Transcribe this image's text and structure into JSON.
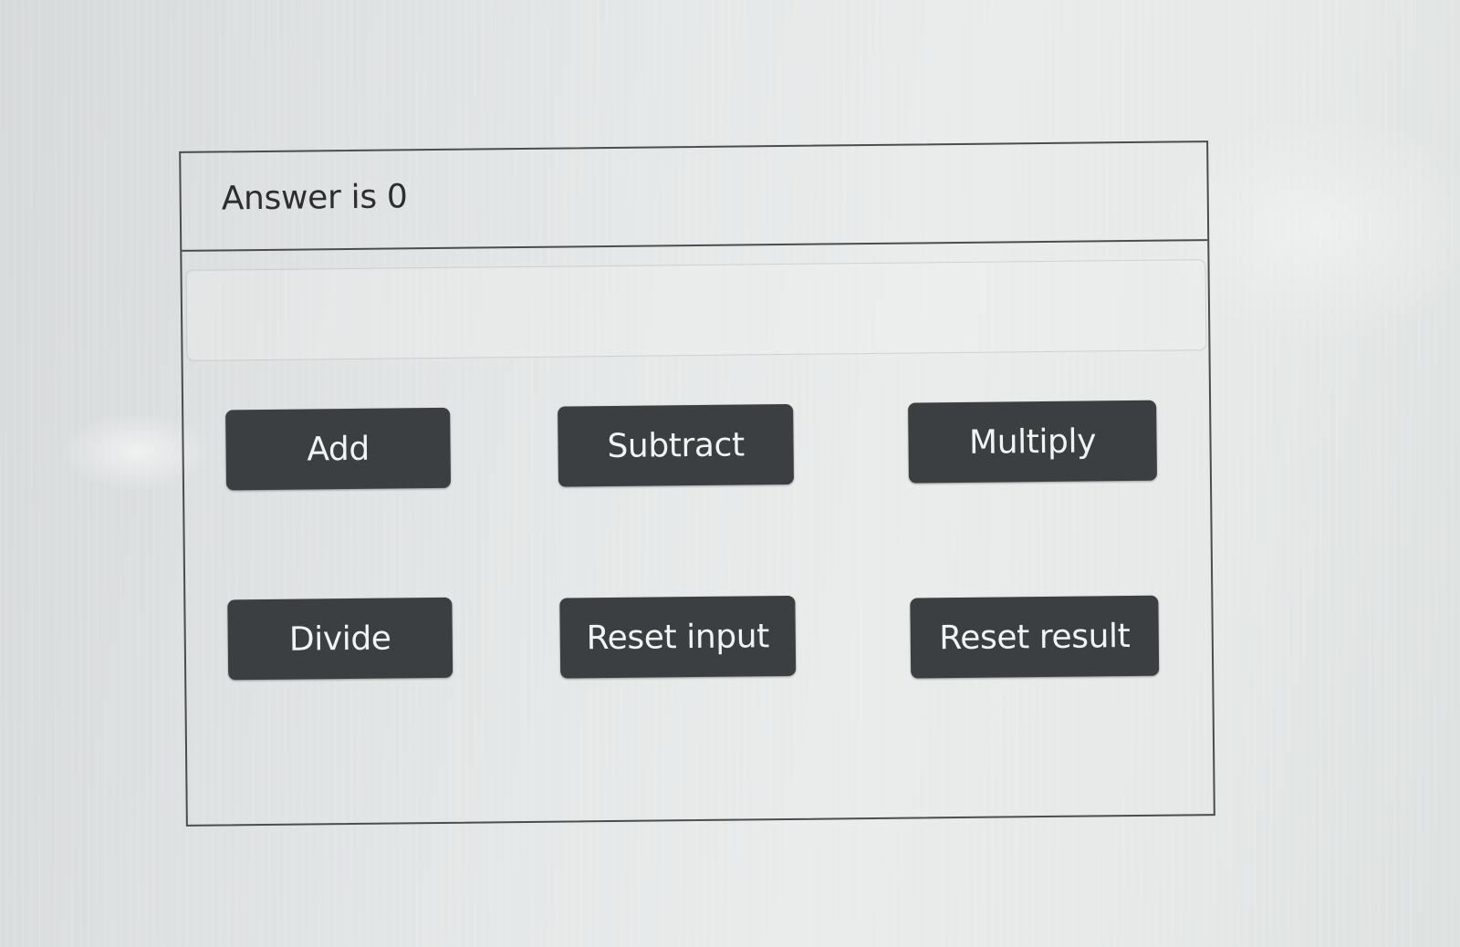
{
  "answer": {
    "text": "Answer is 0"
  },
  "input": {
    "value": "",
    "placeholder": ""
  },
  "buttons": {
    "add": "Add",
    "subtract": "Subtract",
    "multiply": "Multiply",
    "divide": "Divide",
    "reset_input": "Reset input",
    "reset_result": "Reset result"
  },
  "colors": {
    "button_bg": "#3b3f42",
    "button_text": "#f2f4f4",
    "border": "#4a4d4f",
    "text": "#2c2e30"
  }
}
